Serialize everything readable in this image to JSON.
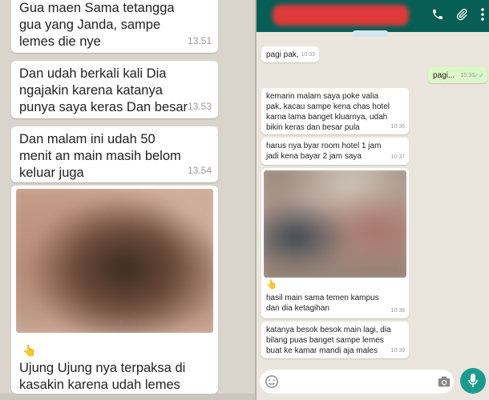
{
  "left": {
    "messages": [
      {
        "text": "Gua maen Sama tetangga\ngua yang Janda, sampe\nlemes die nye",
        "time": "13.51"
      },
      {
        "text": "Dan udah berkali kali Dia\nngajakin karena katanya\npunya saya keras Dan besar",
        "time": "13.53"
      },
      {
        "text": "Dan malam ini udah 50\nmenit an main masih belom\nkeluar juga",
        "time": "13.54"
      },
      {
        "text": "Ujung Ujung nya terpaksa di\nkasakin karena udah lemes"
      }
    ],
    "photo_emoji": "👆"
  },
  "right": {
    "header_icons": [
      "phone-icon",
      "paperclip-icon",
      "more-vert-icon"
    ],
    "messages": [
      {
        "text": "pagi pak,",
        "time": "10:33",
        "dir": "in"
      },
      {
        "text": "pagi...",
        "time": "10:33",
        "dir": "out",
        "ticks": "✓✓"
      },
      {
        "text": "kemarin malam saya poke valia\npak, kacau  sampe kena chas hotel\nkarna lama banget kluarnya, udah\nbikin keras dan besar pula",
        "time": "10:36",
        "dir": "in"
      },
      {
        "text": "harus nya byar room hotel 1 jam\njadi kena bayar 2 jam saya",
        "time": "10:37",
        "dir": "in"
      },
      {
        "text": "hasil main sama temen kampus\ndan dia ketagihan",
        "time": "10:38",
        "dir": "in"
      },
      {
        "text": "katanya besok besok main lagi, dia\nbilang puas banget sampe lemes\nbuat ke kamar mandi aja males",
        "time": "10:39",
        "dir": "in"
      }
    ],
    "photo_emoji": "👆",
    "input_icons": [
      "emoji-icon",
      "camera-icon",
      "mic-icon"
    ]
  }
}
